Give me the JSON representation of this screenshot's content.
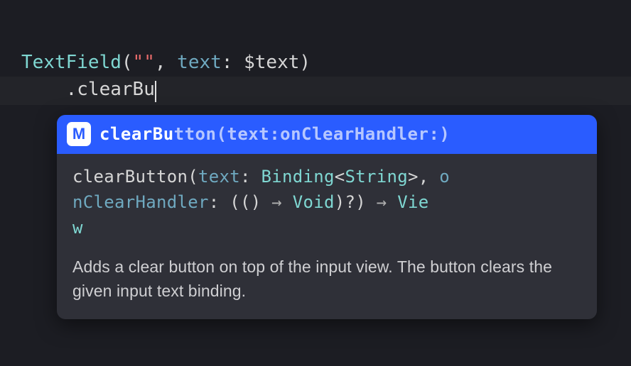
{
  "code": {
    "line1": {
      "type": "TextField",
      "lparen": "(",
      "string_quoted": "\"\"",
      "comma_space": ", ",
      "param_label": "text",
      "colon_space": ": ",
      "binding_prefix": "$",
      "binding_var": "text",
      "rparen": ")"
    },
    "line2": {
      "indent": "    ",
      "dot": ".",
      "typed": "clearBu"
    }
  },
  "autocomplete": {
    "badge": "M",
    "selected": {
      "match": "clearBu",
      "rest": "tton(text:onClearHandler:)"
    },
    "signature": {
      "name": "clearButton",
      "open": "(",
      "p1_label": "text",
      "p1_colon": ": ",
      "p1_type1": "Binding",
      "p1_ang_open": "<",
      "p1_type2": "String",
      "p1_ang_close": ">",
      "sep": ", ",
      "p2_label_part1": "o",
      "p2_label_part2": "nClearHandler",
      "p2_colon": ": ",
      "p2_open": "((",
      "p2_close1": ") ",
      "arrow1": "→",
      "p2_space1": " ",
      "p2_return": "Void",
      "p2_close2": ")?",
      "close": ") ",
      "arrow2": "→",
      "ret_space": " ",
      "ret_type_part1": "Vie",
      "ret_type_part2": "w"
    },
    "doc": "Adds a clear button on top of the input view. The button clears the given input text binding."
  }
}
